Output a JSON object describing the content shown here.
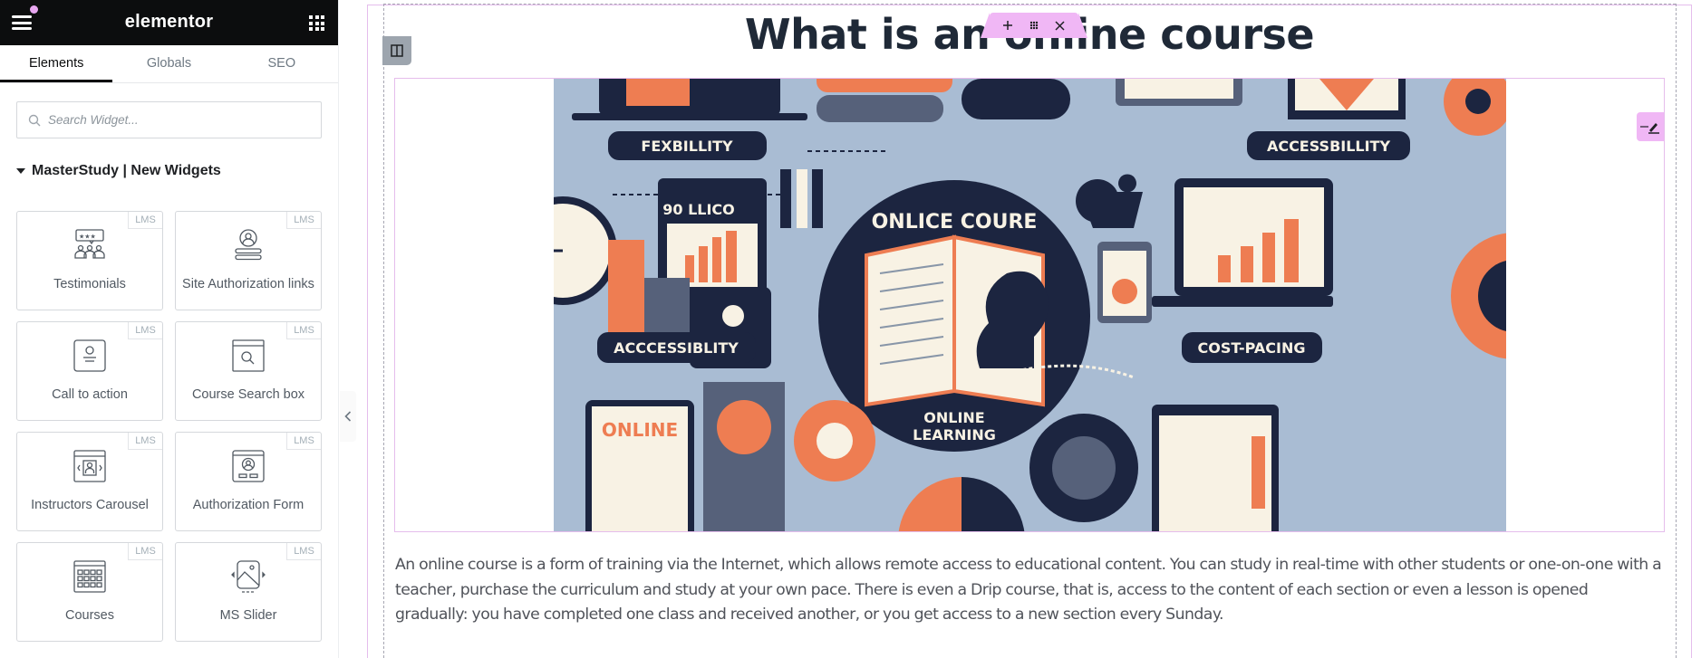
{
  "panel": {
    "logo": "elementor",
    "tabs": [
      {
        "label": "Elements",
        "active": true
      },
      {
        "label": "Globals",
        "active": false
      },
      {
        "label": "SEO",
        "active": false
      }
    ],
    "search": {
      "placeholder": "Search Widget...",
      "value": ""
    },
    "category": "MasterStudy | New Widgets",
    "widgets": [
      {
        "label": "Testimonials",
        "badge": "LMS",
        "icon": "testimonials-icon"
      },
      {
        "label": "Site Authorization links",
        "badge": "LMS",
        "icon": "user-links-icon"
      },
      {
        "label": "Call to action",
        "badge": "LMS",
        "icon": "call-to-action-icon"
      },
      {
        "label": "Course Search box",
        "badge": "LMS",
        "icon": "search-box-icon"
      },
      {
        "label": "Instructors Carousel",
        "badge": "LMS",
        "icon": "carousel-icon"
      },
      {
        "label": "Authorization Form",
        "badge": "LMS",
        "icon": "auth-form-icon"
      },
      {
        "label": "Courses",
        "badge": "LMS",
        "icon": "courses-grid-icon"
      },
      {
        "label": "MS Slider",
        "badge": "LMS",
        "icon": "slider-image-icon"
      }
    ]
  },
  "canvas": {
    "heading": "What is an online course",
    "image": {
      "alt": "Online course illustration",
      "labels": [
        "FEXBILLITY",
        "ACCESSBILLITY",
        "ONLICE COURE",
        "ONLINE LEARNING",
        "ACCCESSIBLITY",
        "COST-PACING",
        "ONLINE",
        "90 LLICO"
      ]
    },
    "paragraph": "An online course is a form of training via the Internet, which allows remote access to educational content. You can study in real-time with other students or one-on-one with a teacher, purchase the curriculum and study at your own pace. There is even a Drip course, that is, access to the content of each section or even a lesson is opened gradually: you have completed one class and received another, or you get access to a new section every Sunday."
  },
  "colors": {
    "header_bg": "#0c0d0e",
    "accent_pink": "#f0b7f5",
    "heading_text": "#1f2937",
    "body_text": "#50535a",
    "illustration_bg": "#a9bcd3",
    "illustration_navy": "#1c2540",
    "illustration_orange": "#ee7d52",
    "illustration_cream": "#f8f2e4"
  }
}
